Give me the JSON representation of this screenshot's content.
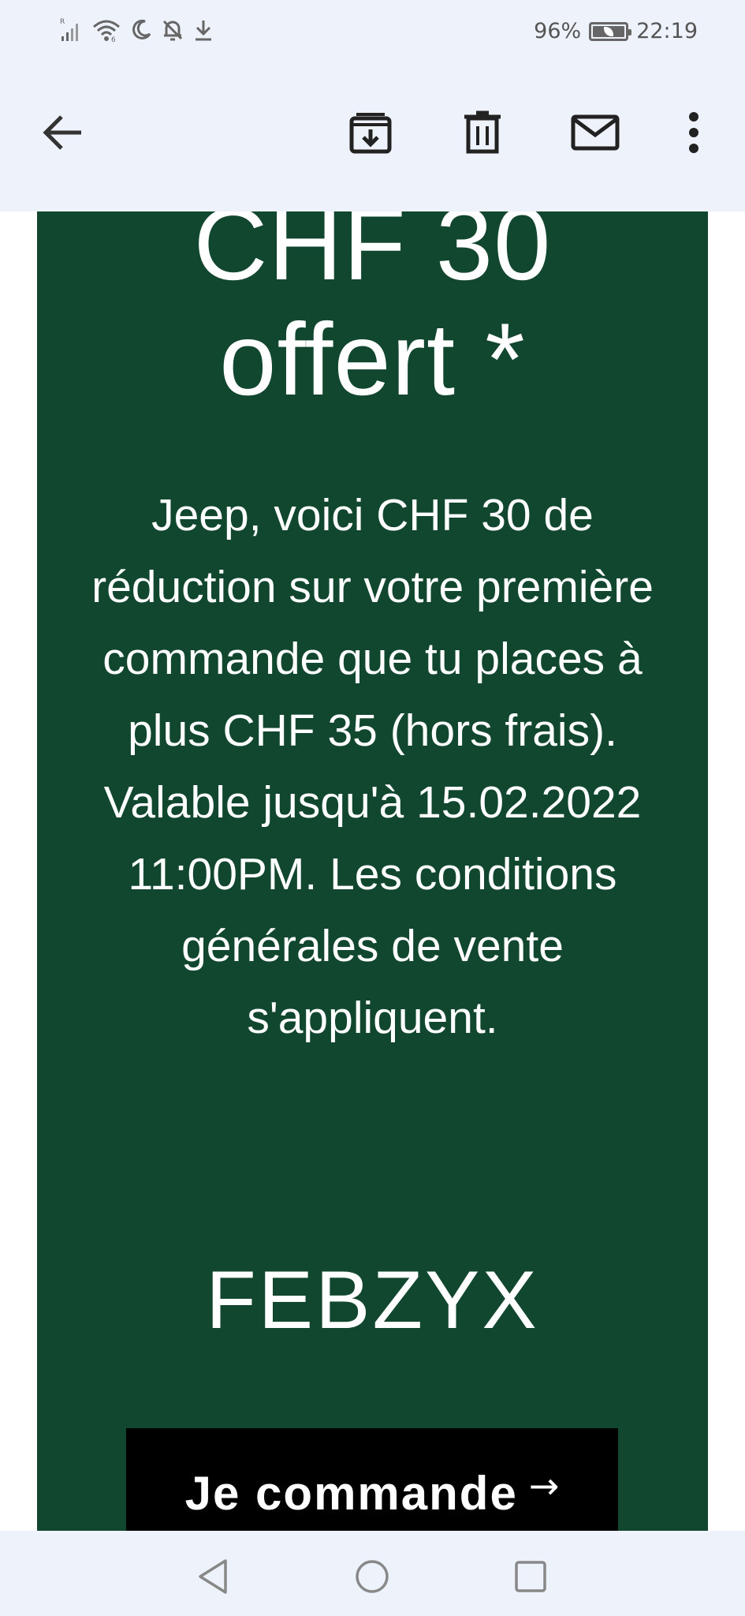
{
  "status_bar": {
    "battery_percent": "96%",
    "time": "22:19",
    "icons": [
      "signal-icon",
      "wifi-icon",
      "moon-icon",
      "bell-off-icon",
      "download-icon"
    ]
  },
  "toolbar": {
    "icons": [
      "back-arrow-icon",
      "archive-icon",
      "trash-icon",
      "mail-icon",
      "more-vertical-icon"
    ]
  },
  "promo": {
    "headline_line1": "CHF 30",
    "headline_line2": "offert *",
    "body": "Jeep, voici CHF 30 de réduction sur votre première commande que tu places à plus CHF 35 (hors frais). Valable jusqu'à 15.02.2022 11:00PM. Les conditions générales de vente s'appliquent.",
    "code": "FEBZYX",
    "cta_label": "Je commande",
    "cta_arrow": "→"
  },
  "colors": {
    "promo_bg": "#12472f",
    "cta_bg": "#000000",
    "chrome_bg": "#eef2fa"
  },
  "navbar": {
    "icons": [
      "nav-back-icon",
      "nav-home-icon",
      "nav-recents-icon"
    ]
  }
}
